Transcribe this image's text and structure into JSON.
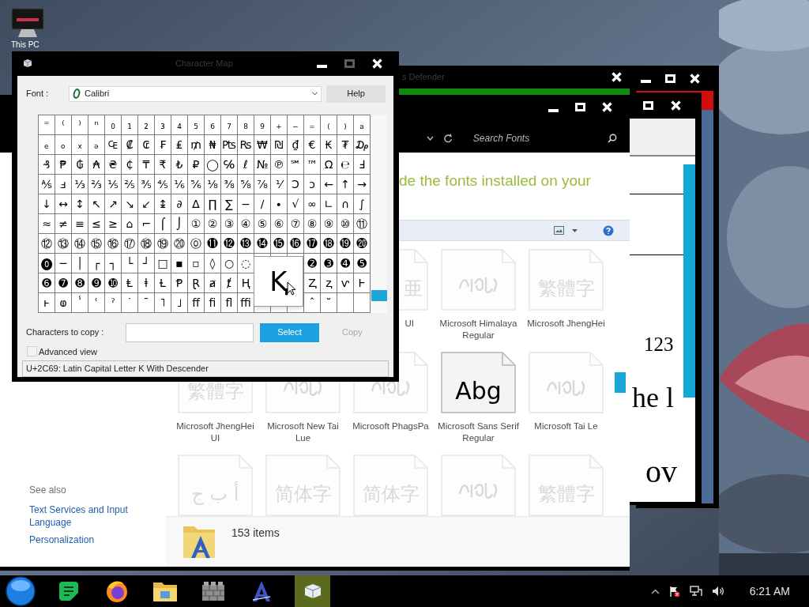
{
  "desktop": {
    "icon_label": "This PC"
  },
  "document_window": {
    "controls_back": [
      {
        "kind": "minimize",
        "disabled": false
      },
      {
        "kind": "maximize",
        "disabled": false
      },
      {
        "kind": "close",
        "disabled": false
      }
    ],
    "controls": [
      {
        "kind": "maximize",
        "disabled": false
      },
      {
        "kind": "close",
        "disabled": false
      }
    ],
    "text_lines": [
      "123",
      "he l",
      "ov"
    ]
  },
  "defender_window": {
    "title": "s Defender",
    "controls": [
      {
        "kind": "close",
        "disabled": false
      }
    ]
  },
  "fonts_window": {
    "controls": [
      {
        "kind": "minimize",
        "disabled": false
      },
      {
        "kind": "maximize",
        "disabled": false
      },
      {
        "kind": "close",
        "disabled": false
      }
    ],
    "search_placeholder": "Search Fonts",
    "heading": "de the fonts installed on your",
    "see_also": "See also",
    "links": [
      "Text Services and Input Language",
      "Personalization"
    ],
    "tile_rows": [
      [
        {
          "kind": "text",
          "preview": "亜",
          "label": "UI",
          "hidden": true
        },
        {
          "kind": "script",
          "label": "Microsoft Himalaya Regular",
          "hidden": true
        },
        {
          "kind": "text",
          "preview": "繁體字",
          "label": "Microsoft JhengHei",
          "hidden": true
        }
      ],
      [
        {
          "kind": "text",
          "preview": "繁體字",
          "label": "Microsoft JhengHei UI",
          "hidden": true
        },
        {
          "kind": "script",
          "label": "Microsoft New Tai Lue",
          "hidden": true
        },
        {
          "kind": "script",
          "label": "Microsoft PhagsPa",
          "hidden": true
        },
        {
          "kind": "text",
          "preview": "Abg",
          "label": "Microsoft Sans Serif Regular",
          "hidden": false
        },
        {
          "kind": "script",
          "label": "Microsoft Tai Le",
          "hidden": true
        }
      ],
      [
        {
          "kind": "text",
          "preview": "أ ب ج",
          "hidden": true
        },
        {
          "kind": "text",
          "preview": "简体字",
          "hidden": true
        },
        {
          "kind": "text",
          "preview": "简体字",
          "hidden": true
        },
        {
          "kind": "script",
          "hidden": true
        },
        {
          "kind": "text",
          "preview": "繁體字",
          "hidden": true
        }
      ]
    ],
    "status": "153 items"
  },
  "charmap": {
    "title": "Character Map",
    "controls": [
      {
        "kind": "minimize",
        "disabled": false
      },
      {
        "kind": "maximize",
        "disabled": true
      },
      {
        "kind": "close",
        "disabled": false
      }
    ],
    "font_label": "Font :",
    "font": "Calibri",
    "help": "Help",
    "grid": [
      {
        "cells": [
          "⁼",
          "⁽",
          "⁾",
          "ⁿ",
          "₀",
          "₁",
          "₂",
          "₃",
          "₄",
          "₅",
          "₆",
          "₇",
          "₈",
          "₉",
          "₊",
          "₋",
          "₌",
          "₍",
          "₎",
          "ₐ"
        ]
      },
      {
        "cells": [
          "ₑ",
          "ₒ",
          "ₓ",
          "ₔ",
          "₠",
          "₡",
          "₢",
          "₣",
          "₤",
          "₥",
          "₦",
          "₧",
          "₨",
          "₩",
          "₪",
          "₫",
          "€",
          "₭",
          "₮",
          "₯"
        ]
      },
      {
        "cells": [
          "₰",
          "₱",
          "₲",
          "₳",
          "₴",
          "₵",
          "₸",
          "₹",
          "₺",
          "₽",
          "◯",
          "℅",
          "ℓ",
          "№",
          "℗",
          "℠",
          "™",
          "Ω",
          "℮",
          "Ⅎ"
        ]
      },
      {
        "cells": [
          "⅍",
          "ⅎ",
          "⅓",
          "⅔",
          "⅕",
          "⅖",
          "⅗",
          "⅘",
          "⅙",
          "⅚",
          "⅛",
          "⅜",
          "⅝",
          "⅞",
          "⅟",
          "Ↄ",
          "ↄ",
          "←",
          "↑",
          "→"
        ]
      },
      {
        "cells": [
          "↓",
          "↔",
          "↕",
          "↖",
          "↗",
          "↘",
          "↙",
          "↨",
          "∂",
          "∆",
          "∏",
          "∑",
          "−",
          "∕",
          "∙",
          "√",
          "∞",
          "∟",
          "∩",
          "∫"
        ]
      },
      {
        "cells": [
          "≈",
          "≠",
          "≡",
          "≤",
          "≥",
          "⌂",
          "⌐",
          "⌠",
          "⌡",
          "①",
          "②",
          "③",
          "④",
          "⑤",
          "⑥",
          "⑦",
          "⑧",
          "⑨",
          "⑩",
          "⑪"
        ]
      },
      {
        "cells": [
          "⑫",
          "⑬",
          "⑭",
          "⑮",
          "⑯",
          "⑰",
          "⑱",
          "⑲",
          "⑳",
          "⓪",
          "⓫",
          "⓬",
          "⓭",
          "⓮",
          "⓯",
          "⓰",
          "⓱",
          "⓲",
          "⓳",
          "⓴"
        ]
      },
      {
        "cells": [
          "⓿",
          "─",
          "│",
          "┌",
          "┐",
          "└",
          "┘",
          "□",
          "▪",
          "▫",
          "◊",
          "○",
          "◌"
        ],
        "cells_right": [
          "➋",
          "➌",
          "➍",
          "➎"
        ]
      },
      {
        "cells": [
          "➏",
          "➐",
          "➑",
          "➒",
          "➓",
          "Ⱡ",
          "ⱡ",
          "Ɫ",
          "Ᵽ",
          "Ɽ",
          "ⱥ",
          "ⱦ",
          "Ⱨ"
        ],
        "cells_right": [
          "Ⱬ",
          "ⱬ",
          "ⱱ",
          "Ⱶ"
        ]
      },
      {
        "cells": [
          "ⱶ",
          "ⱷ",
          "ⸯ",
          "ʿ",
          "ˀ",
          "˙",
          "ˉ",
          "˥",
          "˩",
          "ﬀ",
          "ﬁ",
          "ﬂ",
          "ﬃ"
        ],
        "cells_right": [
          "ˆ",
          "˘"
        ]
      }
    ],
    "magnified": "Ⱪ",
    "copy_label": "Characters to copy :",
    "select": "Select",
    "copy": {
      "label": "Copy",
      "disabled": true
    },
    "advanced": {
      "label": "Advanced view",
      "checked": false
    },
    "status": "U+2C69: Latin Capital Letter K With Descender"
  },
  "taskbar": {
    "apps": [
      {
        "kind": "start",
        "active": false
      },
      {
        "kind": "notes",
        "active": false
      },
      {
        "kind": "browser",
        "active": false
      },
      {
        "kind": "files",
        "active": false
      },
      {
        "kind": "wall",
        "active": false
      },
      {
        "kind": "fonts",
        "active": false
      },
      {
        "kind": "charmap",
        "active": true
      }
    ],
    "clock": "6:21 AM"
  }
}
